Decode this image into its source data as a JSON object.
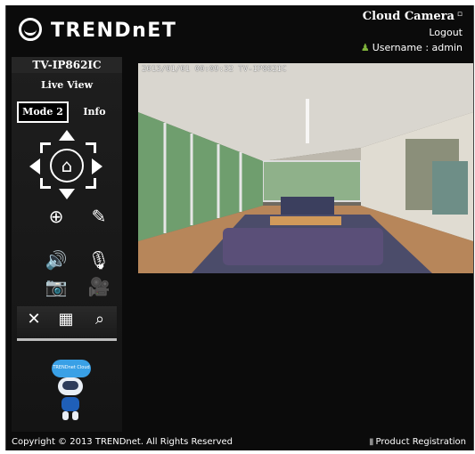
{
  "header": {
    "brand": "TRENDnET",
    "product_title": "Cloud Camera",
    "product_title_icon": "window-icon",
    "logout_label": "Logout",
    "user_label": "Username : admin",
    "user_icon": "user-icon"
  },
  "sidebar": {
    "model": "TV-IP862IC",
    "live_view_label": "Live View",
    "tabs": [
      {
        "label": "Mode 2",
        "active": true
      },
      {
        "label": "Info",
        "active": false
      }
    ],
    "ptz_icons": [
      "arrow-up-icon",
      "arrow-down-icon",
      "arrow-left-icon",
      "arrow-right-icon",
      "home-icon"
    ],
    "control_icons": [
      "target-icon",
      "pencil-icon",
      "speaker-icon",
      "mic-mute-icon",
      "snapshot-icon",
      "record-icon"
    ],
    "bottom_icons": [
      "tools-icon",
      "film-icon",
      "zoom-icon"
    ],
    "mascot_cloud_text": "TRENDnet Cloud"
  },
  "camera": {
    "overlay_text": "2013/01/01 00:09:32 TV-IP862IC"
  },
  "footer": {
    "copyright": "Copyright © 2013 TRENDnet. All Rights Reserved",
    "registration": "Product Registration"
  },
  "colors": {
    "background": "#0b0b0b",
    "accent_green": "#7fb33b",
    "cloud_blue": "#39a0e6"
  }
}
